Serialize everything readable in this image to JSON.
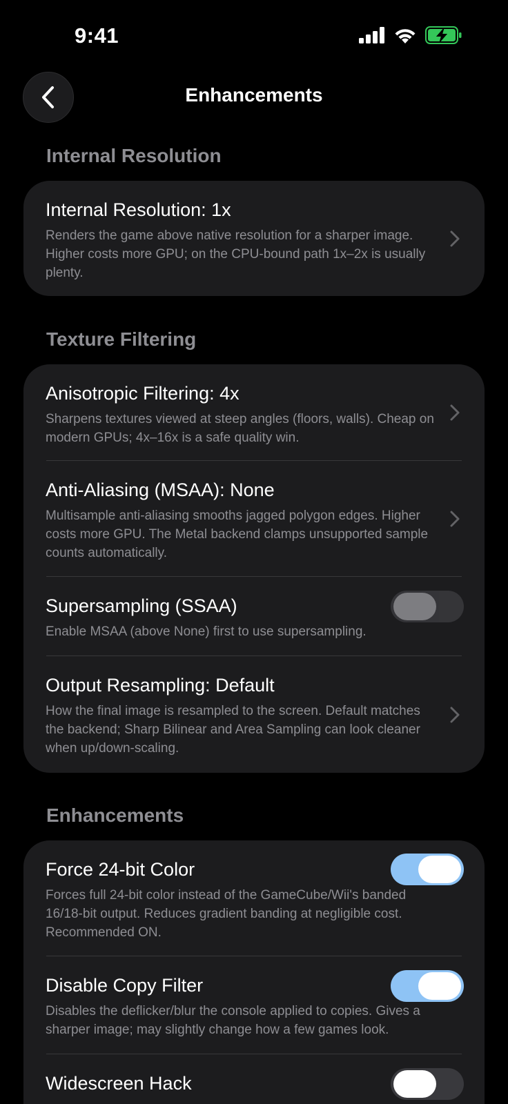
{
  "status": {
    "time": "9:41"
  },
  "nav": {
    "title": "Enhancements"
  },
  "sections": [
    {
      "header": "Internal Resolution",
      "rows": [
        {
          "title": "Internal Resolution: 1x",
          "description": "Renders the game above native resolution for a sharper image. Higher costs more GPU; on the CPU-bound path 1x–2x is usually plenty.",
          "control": "chevron"
        }
      ]
    },
    {
      "header": "Texture Filtering",
      "rows": [
        {
          "title": "Anisotropic Filtering: 4x",
          "description": "Sharpens textures viewed at steep angles (floors, walls). Cheap on modern GPUs; 4x–16x is a safe quality win.",
          "control": "chevron"
        },
        {
          "title": "Anti-Aliasing (MSAA): None",
          "description": "Multisample anti-aliasing smooths jagged polygon edges. Higher costs more GPU. The Metal backend clamps unsupported sample counts automatically.",
          "control": "chevron"
        },
        {
          "title": "Supersampling (SSAA)",
          "description": "Enable MSAA (above None) first to use supersampling.",
          "control": "toggle",
          "state": "off-disabled"
        },
        {
          "title": "Output Resampling: Default",
          "description": "How the final image is resampled to the screen. Default matches the backend; Sharp Bilinear and Area Sampling can look cleaner when up/down-scaling.",
          "control": "chevron"
        }
      ]
    },
    {
      "header": "Enhancements",
      "rows": [
        {
          "title": "Force 24-bit Color",
          "description": "Forces full 24-bit color instead of the GameCube/Wii's banded 16/18-bit output. Reduces gradient banding at negligible cost. Recommended ON.",
          "control": "toggle",
          "state": "on"
        },
        {
          "title": "Disable Copy Filter",
          "description": "Disables the deflicker/blur the console applied to copies. Gives a sharper image; may slightly change how a few games look.",
          "control": "toggle",
          "state": "on"
        },
        {
          "title": "Widescreen Hack",
          "description": "",
          "control": "toggle",
          "state": "off"
        }
      ]
    }
  ],
  "colors": {
    "background": "#000000",
    "card": "#1c1c1e",
    "secondary_text": "#8e8e93",
    "toggle_on": "#8ec3f5",
    "battery_green": "#34c759"
  }
}
